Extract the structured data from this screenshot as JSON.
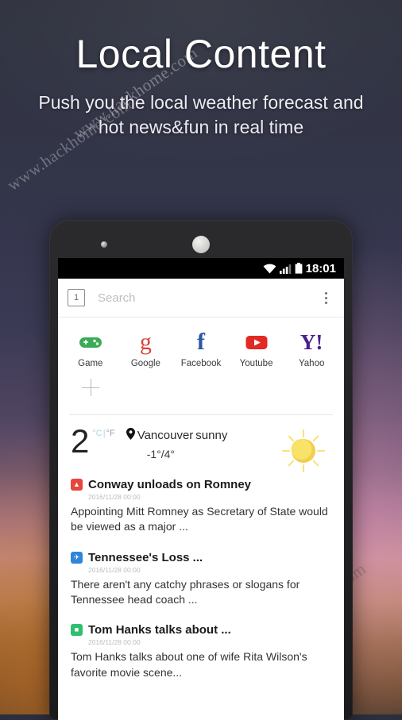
{
  "promo": {
    "title": "Local Content",
    "subtitle": "Push you the local weather forecast and hot news&fun in real time",
    "watermark": "www.hackhome.com"
  },
  "phone": {
    "status_bar": {
      "time": "18:01",
      "wifi_icon": "wifi-icon",
      "signal_icon": "cellular-signal-icon",
      "battery_icon": "battery-full-icon"
    },
    "toolbar": {
      "tab_count": "1",
      "search_placeholder": "Search",
      "search_value": "",
      "menu_icon": "overflow-menu-icon"
    },
    "shortcuts": [
      {
        "label": "Game",
        "icon": "gamepad-icon",
        "color": "#3aab55"
      },
      {
        "label": "Google",
        "icon": "google-icon",
        "color": "#d8453c"
      },
      {
        "label": "Facebook",
        "icon": "facebook-icon",
        "color": "#2d57a5"
      },
      {
        "label": "Youtube",
        "icon": "youtube-icon",
        "color": "#e02a22"
      },
      {
        "label": "Yahoo",
        "icon": "yahoo-icon",
        "color": "#4b1f8c"
      }
    ],
    "add_shortcut_label": "+",
    "weather": {
      "temperature": "2",
      "unit_celsius": "°C",
      "unit_separator": "|",
      "unit_fahrenheit": "°F",
      "location_icon": "location-pin-icon",
      "location": "Vancouver",
      "condition": "sunny",
      "range": "-1°/4°",
      "condition_icon": "sun-icon",
      "sun_color": "#f6dd62"
    },
    "news": [
      {
        "title": "Conway unloads on Romney",
        "date": "2016/11/28 00:00",
        "summary": "Appointing Mitt Romney as Secretary of State would be viewed as a major ...",
        "favicon": "news-source-red-icon",
        "favicon_color": "#e8453c"
      },
      {
        "title": "Tennessee's Loss ...",
        "date": "2016/11/28 00:00",
        "summary": "There aren't any catchy phrases or slogans for Tennessee head coach ...",
        "favicon": "news-source-blue-icon",
        "favicon_color": "#2f86d8"
      },
      {
        "title": "Tom Hanks talks about ...",
        "date": "2016/11/28 00:00",
        "summary": "Tom Hanks talks about one of wife Rita Wilson's favorite movie scene...",
        "favicon": "news-source-green-icon",
        "favicon_color": "#2fbf6e"
      }
    ]
  }
}
